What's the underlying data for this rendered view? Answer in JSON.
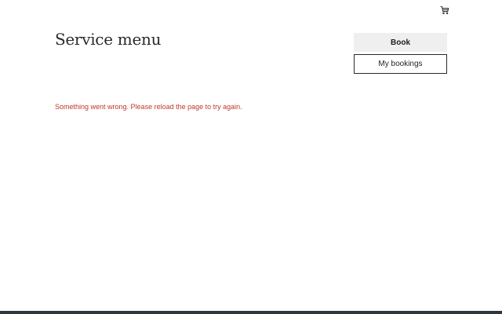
{
  "header": {
    "cart_icon": "shopping-cart-icon"
  },
  "main": {
    "title": "Service menu",
    "error_message": "Something went wrong. Please reload the page to try again."
  },
  "actions": {
    "book_label": "Book",
    "my_bookings_label": "My bookings"
  },
  "colors": {
    "error_text": "#c0392b",
    "book_button_bg": "#efefef",
    "footer_bar": "#2f3640"
  }
}
